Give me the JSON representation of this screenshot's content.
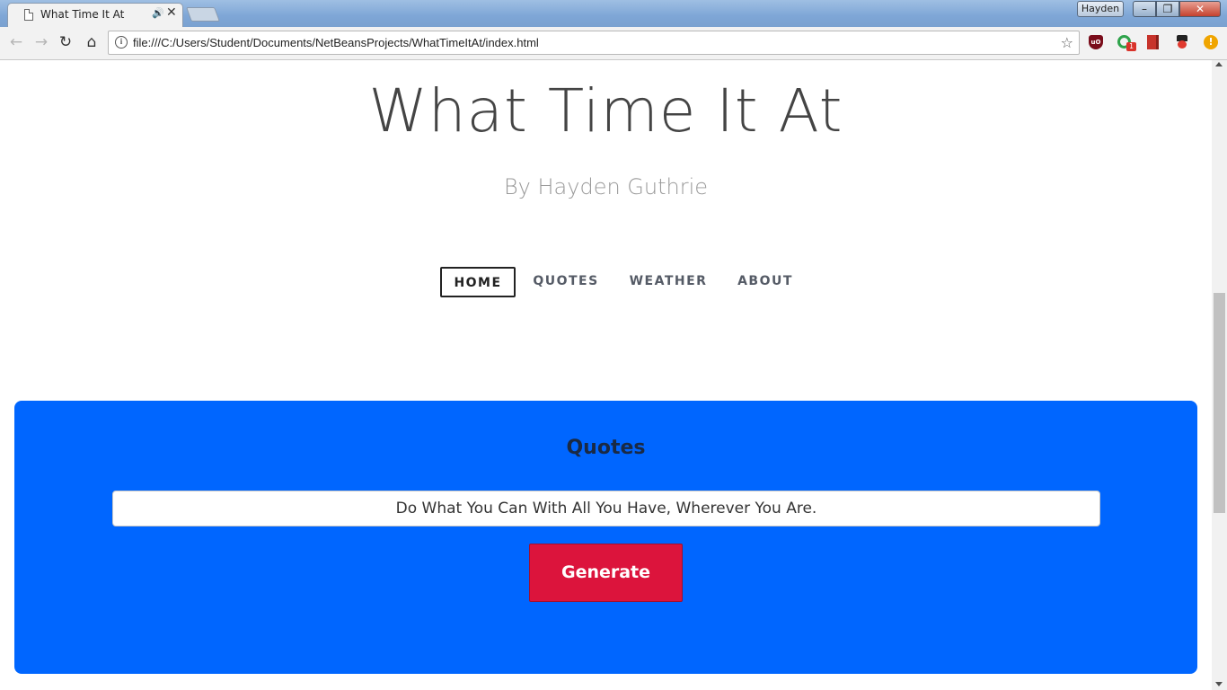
{
  "browser": {
    "tab_title": "What Time It At",
    "new_tab_label": "",
    "user_label": "Hayden",
    "url": "file:///C:/Users/Student/Documents/NetBeansProjects/WhatTimeItAt/index.html",
    "extension_badge": "1",
    "icons": [
      "page-icon",
      "audio-icon",
      "close-icon",
      "back-icon",
      "forward-icon",
      "reload-icon",
      "home-icon",
      "info-icon",
      "star-icon",
      "ublock-icon",
      "extension-icon",
      "book-icon",
      "hat-icon",
      "alert-icon"
    ]
  },
  "site": {
    "title": "What Time It At",
    "subtitle": "By Hayden Guthrie",
    "nav": {
      "home": "HOME",
      "quotes": "QUOTES",
      "weather": "WEATHER",
      "about": "ABOUT",
      "active": "home"
    },
    "quotes": {
      "heading": "Quotes",
      "quote": "Do What You Can With All You Have, Wherever You Are.",
      "button_label": "Generate"
    },
    "colors": {
      "panel": "#0066ff",
      "button": "#dc143c",
      "title": "#444444",
      "subtitle": "#999999"
    }
  }
}
